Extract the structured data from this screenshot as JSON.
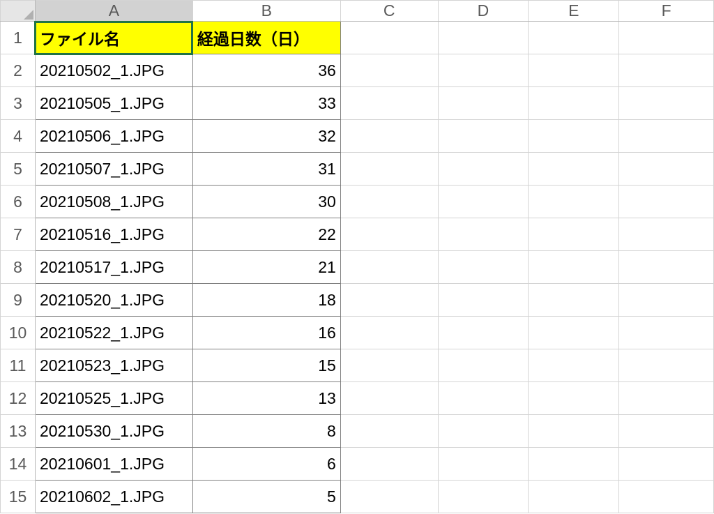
{
  "columns": [
    "A",
    "B",
    "C",
    "D",
    "E",
    "F"
  ],
  "rownums": [
    1,
    2,
    3,
    4,
    5,
    6,
    7,
    8,
    9,
    10,
    11,
    12,
    13,
    14,
    15
  ],
  "headers": {
    "A": "ファイル名",
    "B": "経過日数（日）"
  },
  "rows": [
    {
      "file": "20210502_1.JPG",
      "days": 36
    },
    {
      "file": "20210505_1.JPG",
      "days": 33
    },
    {
      "file": "20210506_1.JPG",
      "days": 32
    },
    {
      "file": "20210507_1.JPG",
      "days": 31
    },
    {
      "file": "20210508_1.JPG",
      "days": 30
    },
    {
      "file": "20210516_1.JPG",
      "days": 22
    },
    {
      "file": "20210517_1.JPG",
      "days": 21
    },
    {
      "file": "20210520_1.JPG",
      "days": 18
    },
    {
      "file": "20210522_1.JPG",
      "days": 16
    },
    {
      "file": "20210523_1.JPG",
      "days": 15
    },
    {
      "file": "20210525_1.JPG",
      "days": 13
    },
    {
      "file": "20210530_1.JPG",
      "days": 8
    },
    {
      "file": "20210601_1.JPG",
      "days": 6
    },
    {
      "file": "20210602_1.JPG",
      "days": 5
    }
  ]
}
